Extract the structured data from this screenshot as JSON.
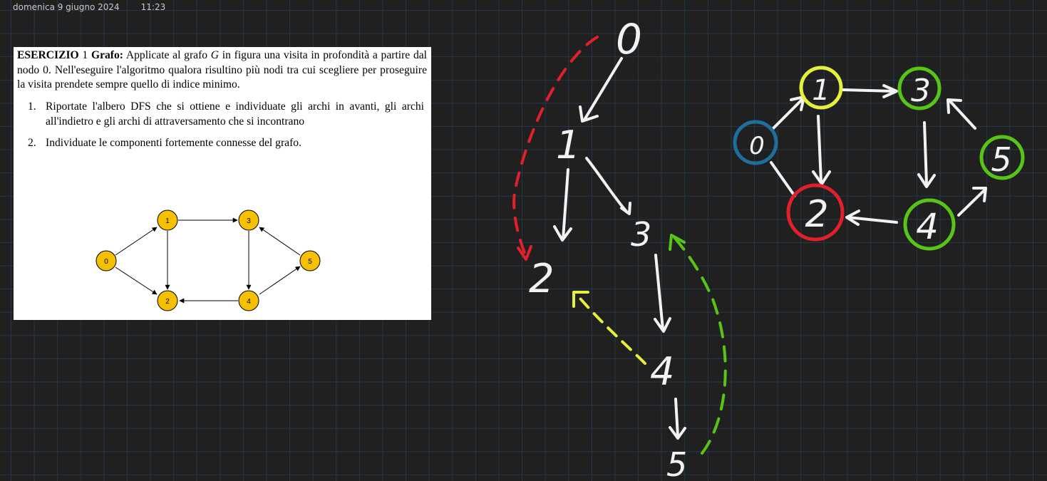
{
  "header": {
    "date": "domenica 9 giugno 2024",
    "time": "11:23"
  },
  "exercise": {
    "heading": "ESERCIZIO",
    "number": "1",
    "topic": "Grafo:",
    "intro_before_g": "Applicate al grafo",
    "graph_symbol": "G",
    "intro_after_g": "in figura una visita in profondità a partire dal nodo 0. Nell'eseguire l'algoritmo qualora risultino più nodi tra cui scegliere per proseguire la visita prendete sempre quello di indice minimo.",
    "items": [
      {
        "num": "1.",
        "text": "Riportate l'albero DFS che si ottiene e individuate gli archi in avanti, gli archi all'indietro e gli archi di attraversamento che si incontrano"
      },
      {
        "num": "2.",
        "text": "Individuate le componenti fortemente connesse del grafo."
      }
    ]
  },
  "figure_graph": {
    "nodes": [
      "0",
      "1",
      "2",
      "3",
      "4",
      "5"
    ],
    "node_color": "#f5c000"
  },
  "dfs_tree": {
    "labels": [
      "0",
      "1",
      "2",
      "3",
      "4",
      "5"
    ]
  },
  "redrawn_graph": {
    "labels": [
      "0",
      "1",
      "2",
      "3",
      "4",
      "5"
    ],
    "colors": {
      "node_0": "#1f6f9a",
      "node_1": "#e6f03c",
      "node_2": "#e0202a",
      "node_3": "#58c418",
      "node_4": "#58c418",
      "node_5": "#58c418"
    }
  },
  "ink_colors": {
    "white": "#f2f2f2",
    "red": "#e0202a",
    "yellow": "#e6f03c",
    "green": "#58c418"
  }
}
